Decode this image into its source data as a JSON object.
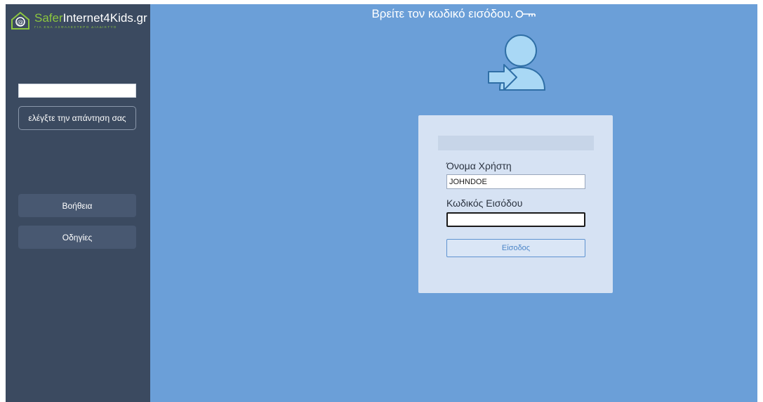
{
  "sidebar": {
    "logo": {
      "title_part1": "Safer",
      "title_part2": "Internet4Kids.gr",
      "subtitle": "ΓΙΑ ΕΝΑ ΑΣΦΑΛΕΣΤΕΡΟ ΔΙΑΔΙΚΤΥΟ"
    },
    "answer_input": {
      "value": "",
      "placeholder": ""
    },
    "check_button_label": "ελέγξτε την απάντηση σας",
    "help_button_label": "Βοήθεια",
    "instructions_button_label": "Οδηγίες"
  },
  "main": {
    "title": "Βρείτε τον κωδικό εισόδου.",
    "login": {
      "username_label": "Όνομα Χρήστη",
      "username_value": "JOHNDOE",
      "password_label": "Κωδικός Εισόδου",
      "password_value": "",
      "login_button_label": "Είσοδος"
    }
  },
  "icons": {
    "logo": "safer-internet-logo-icon",
    "title": "key-icon",
    "illustration": "user-login-icon"
  },
  "colors": {
    "sidebar_bg": "#3b4a60",
    "main_bg": "#6b9fd8",
    "card_bg": "#d6e2f3",
    "accent_green": "#8cc63f",
    "illustration_fill": "#a9d8f5",
    "illustration_stroke": "#2f6fa6"
  }
}
